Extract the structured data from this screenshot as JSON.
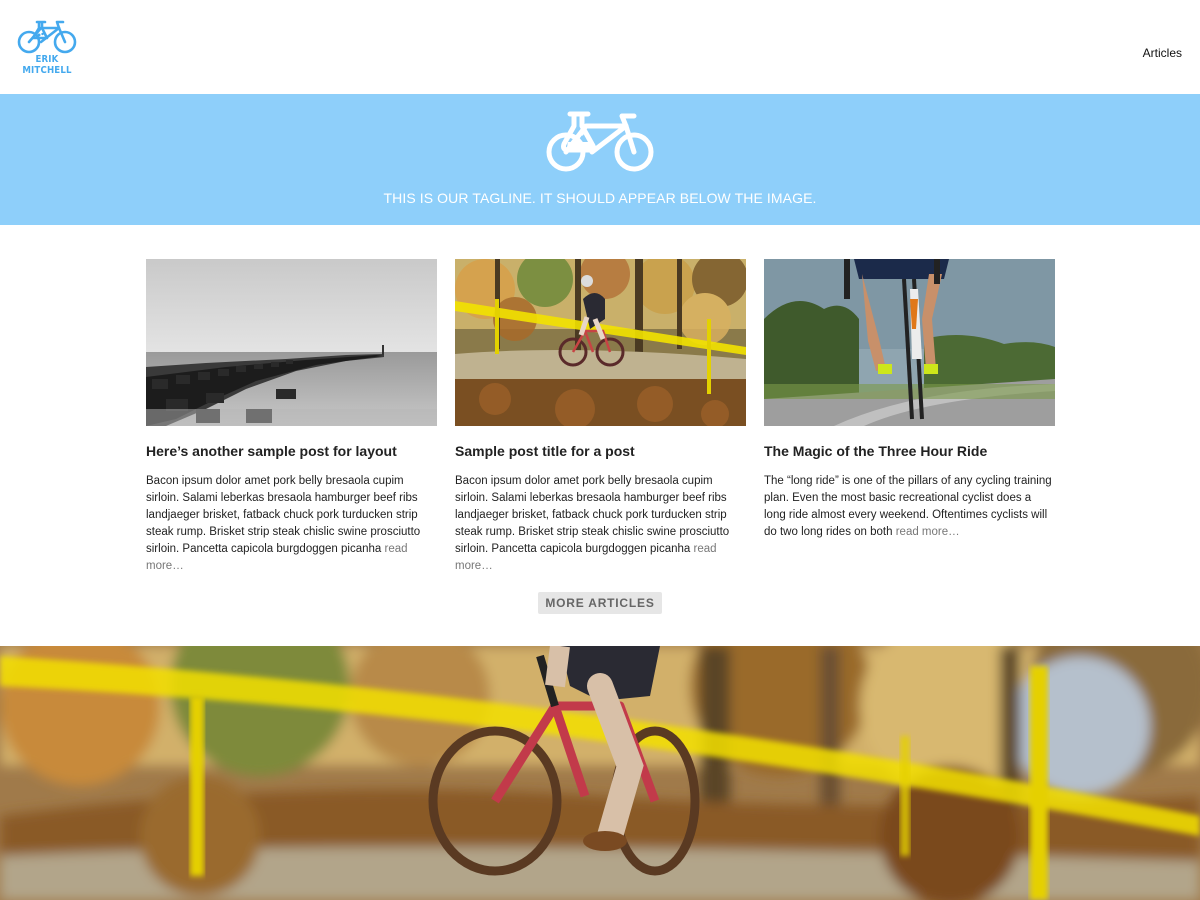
{
  "header": {
    "logo_text": "ERIK MITCHELL",
    "nav": [
      {
        "label": "Articles"
      }
    ]
  },
  "hero": {
    "tagline": "THIS IS OUR TAGLINE. IT SHOULD APPEAR BELOW THE IMAGE."
  },
  "posts": [
    {
      "title": "Here’s another sample post for layout",
      "excerpt": "Bacon ipsum dolor amet pork belly bresaola cupim sirloin. Salami leberkas bresaola hamburger beef ribs landjaeger brisket, fatback chuck pork turducken strip steak rump. Brisket strip steak chislic swine prosciutto sirloin. Pancetta capicola burgdoggen picanha",
      "read_more": "read more…",
      "image": "black-and-white-pier-photo"
    },
    {
      "title": "Sample post title for a post",
      "excerpt": "Bacon ipsum dolor amet pork belly bresaola cupim sirloin. Salami leberkas bresaola hamburger beef ribs landjaeger brisket, fatback chuck pork turducken strip steak rump. Brisket strip steak chislic swine prosciutto sirloin. Pancetta capicola burgdoggen picanha",
      "read_more": "read more…",
      "image": "cyclocross-rider-photo"
    },
    {
      "title": "The Magic of the Three Hour Ride",
      "excerpt": "The “long ride” is one of the pillars of any cycling training plan. Even the most basic recreational cyclist does a long ride almost every weekend. Oftentimes cyclists will do two long rides on both",
      "read_more": "read more…",
      "image": "road-cyclist-photo"
    }
  ],
  "more_button": "MORE ARTICLES",
  "colors": {
    "accent": "#8ecffa",
    "logo": "#44a9ee",
    "button_bg": "#e6e6e6"
  },
  "icons": [
    "bicycle-flask-logo-icon",
    "bicycle-flask-hero-icon"
  ]
}
